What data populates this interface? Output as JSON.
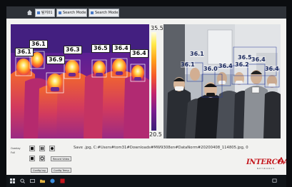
{
  "window": {
    "tabs": [
      {
        "label": "탐지01"
      },
      {
        "label": "Search Mode"
      },
      {
        "label": "Search Mode"
      }
    ]
  },
  "thermal_view": {
    "scale_max": "35.5",
    "scale_min": "20.5",
    "readings": [
      "36.1",
      "36.1",
      "36.9",
      "36.3",
      "36.5",
      "36.4",
      "36.4"
    ]
  },
  "visible_view": {
    "readings": [
      "36.1",
      "36.1",
      "36.0",
      "36.4",
      "36.2",
      "36.5",
      "36.4",
      "36.4"
    ]
  },
  "controls": {
    "side_labels": [
      "Overlay",
      "Full"
    ],
    "save_path": "Save .jpg, C:#Users#tom31#Downloads#MW9308en#DataNorm#20200408_114805.jpg, 0",
    "buttons": [
      "Record Video",
      "Config log",
      "Config Temp"
    ]
  },
  "brand": {
    "logo": "INTERCOAX",
    "sub": "NETWORKS"
  },
  "colors": {
    "logo": "#c4161c",
    "tag_border": "#1c2a5e"
  }
}
